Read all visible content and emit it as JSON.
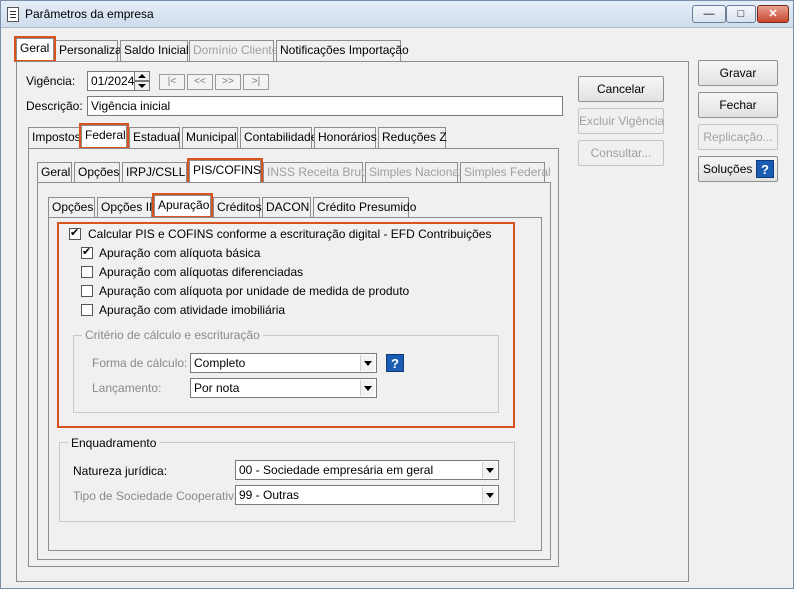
{
  "window": {
    "title": "Parâmetros da empresa",
    "minimize": "—",
    "restore": "□",
    "close": "✕",
    "icon": "document-icon"
  },
  "main_tabs": [
    "Geral",
    "Personaliza",
    "Saldo Inicial",
    "Domínio Cliente",
    "Notificações Importação"
  ],
  "vigencia": {
    "label": "Vigência:",
    "value": "01/2024",
    "nav": [
      "|<",
      "<<",
      ">>",
      ">|"
    ]
  },
  "descricao": {
    "label": "Descrição:",
    "value": "Vigência inicial"
  },
  "tax_tabs": [
    "Impostos",
    "Federal",
    "Estadual",
    "Municipal",
    "Contabilidade",
    "Honorários",
    "Reduções Z"
  ],
  "federal_tabs": [
    "Geral",
    "Opções",
    "IRPJ/CSLL",
    "PIS/COFINS",
    "INSS Receita Bruta",
    "Simples Nacional",
    "Simples Federal"
  ],
  "pis_tabs": [
    "Opções",
    "Opções II",
    "Apuração",
    "Créditos",
    "DACON",
    "Crédito Presumido"
  ],
  "apuracao": {
    "main_checkbox": "Calcular PIS e COFINS conforme a escrituração digital - EFD Contribuições",
    "options": [
      {
        "label": "Apuração com alíquota básica",
        "checked": true
      },
      {
        "label": "Apuração com alíquotas diferenciadas",
        "checked": false
      },
      {
        "label": "Apuração com alíquota por unidade de medida de produto",
        "checked": false
      },
      {
        "label": "Apuração com atividade imobiliária",
        "checked": false
      }
    ],
    "criterio": {
      "title": "Critério de cálculo e escrituração",
      "forma_label": "Forma de cálculo:",
      "forma_value": "Completo",
      "lancamento_label": "Lançamento:",
      "lancamento_value": "Por nota",
      "help": "?"
    }
  },
  "enquadramento": {
    "title": "Enquadramento",
    "natureza_label": "Natureza jurídica:",
    "natureza_value": "00 - Sociedade empresária em geral",
    "tipo_label": "Tipo de Sociedade Cooperativa:",
    "tipo_value": "99 - Outras"
  },
  "side_buttons": {
    "cancelar": "Cancelar",
    "excluir": "Excluir Vigência",
    "consultar": "Consultar..."
  },
  "right_buttons": {
    "gravar": "Gravar",
    "fechar": "Fechar",
    "replicacao": "Replicação...",
    "solucoes": "Soluções",
    "help": "?"
  },
  "colors": {
    "highlight": "#d9531e",
    "help_blue": "#1b5cb3"
  }
}
